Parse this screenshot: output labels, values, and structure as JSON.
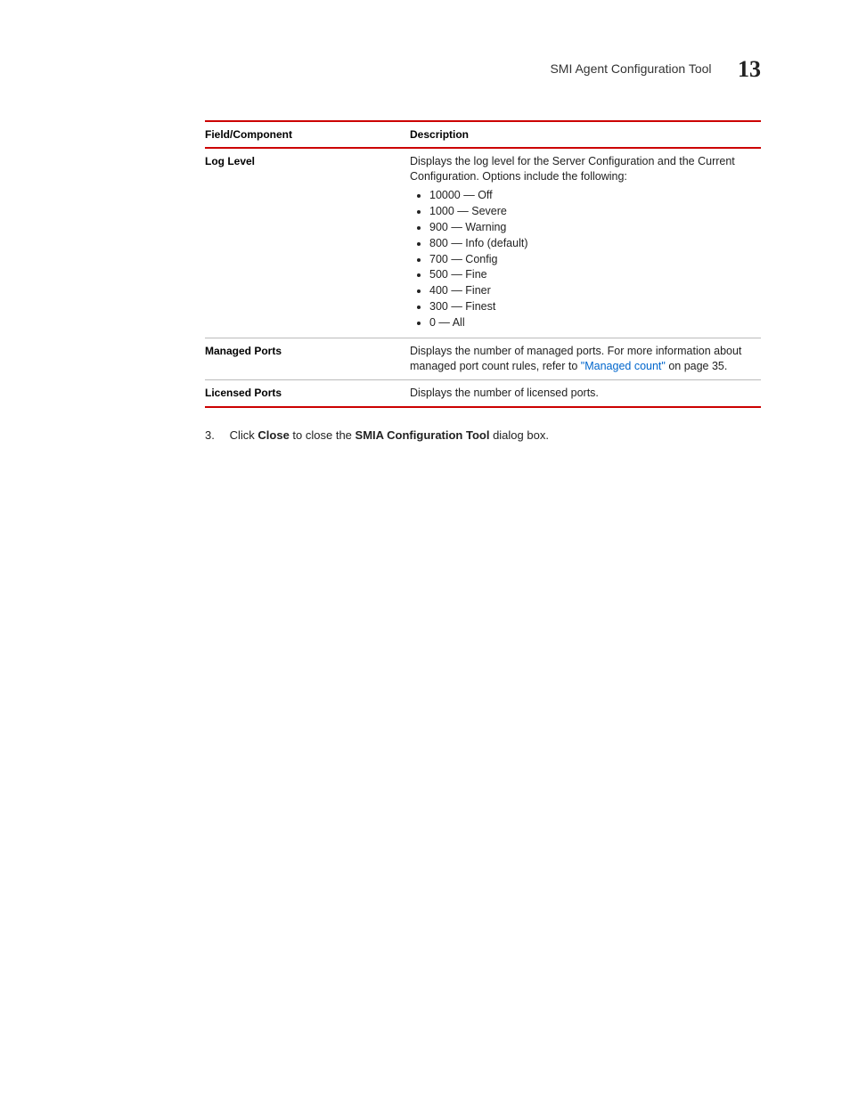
{
  "header": {
    "title": "SMI Agent Configuration Tool",
    "chapter": "13"
  },
  "table": {
    "head": {
      "field": "Field/Component",
      "desc": "Description"
    },
    "rows": {
      "loglevel": {
        "field": "Log Level",
        "intro": "Displays the log level for the Server Configuration and the Current Configuration. Options include the following:",
        "items": [
          "10000 — Off",
          "1000 — Severe",
          "900 — Warning",
          "800 — Info (default)",
          "700 — Config",
          "500 — Fine",
          "400 — Finer",
          "300 — Finest",
          "0 — All"
        ]
      },
      "managed": {
        "field": "Managed Ports",
        "pre": "Displays the number of managed ports. For more information about managed port count rules, refer to ",
        "link": "\"Managed count\"",
        "post": " on page 35."
      },
      "licensed": {
        "field": "Licensed Ports",
        "desc": "Displays the number of licensed ports."
      }
    }
  },
  "step": {
    "num": "3.",
    "pre": "Click ",
    "b1": "Close",
    "mid": " to close the ",
    "b2": "SMIA Configuration Tool",
    "post": " dialog box."
  }
}
